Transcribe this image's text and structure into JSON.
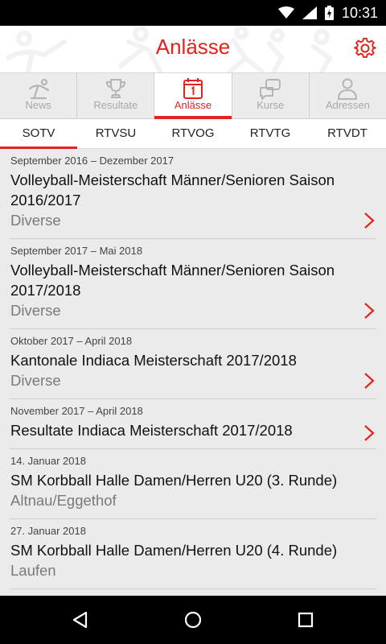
{
  "status": {
    "time": "10:31"
  },
  "header": {
    "title": "Anlässe",
    "settings_icon": "gear-icon",
    "accent_color": "#e4231b"
  },
  "tabs": [
    {
      "label": "News",
      "icon": "gymnast-icon",
      "active": false
    },
    {
      "label": "Resultate",
      "icon": "trophy-icon",
      "active": false
    },
    {
      "label": "Anlässe",
      "icon": "calendar-icon",
      "active": true
    },
    {
      "label": "Kurse",
      "icon": "chat-icon",
      "active": false
    },
    {
      "label": "Adressen",
      "icon": "person-icon",
      "active": false
    }
  ],
  "subtabs": [
    {
      "label": "SOTV",
      "active": true
    },
    {
      "label": "RTVSU",
      "active": false
    },
    {
      "label": "RTVOG",
      "active": false
    },
    {
      "label": "RTVTG",
      "active": false
    },
    {
      "label": "RTVDT",
      "active": false
    }
  ],
  "events": [
    {
      "date": "September 2016 – Dezember 2017",
      "title": "Volleyball-Meisterschaft Männer/Senioren Saison 2016/2017",
      "location": "Diverse",
      "has_chevron": true
    },
    {
      "date": "September 2017 – Mai 2018",
      "title": "Volleyball-Meisterschaft Männer/Senioren Saison 2017/2018",
      "location": "Diverse",
      "has_chevron": true
    },
    {
      "date": "Oktober 2017 – April 2018",
      "title": "Kantonale Indiaca Meisterschaft 2017/2018",
      "location": "Diverse",
      "has_chevron": true
    },
    {
      "date": "November 2017 – April 2018",
      "title": "Resultate Indiaca Meisterschaft 2017/2018",
      "location": "",
      "has_chevron": true
    },
    {
      "date": "14. Januar 2018",
      "title": "SM Korbball Halle Damen/Herren U20 (3. Runde)",
      "location": "Altnau/Eggethof",
      "has_chevron": false
    },
    {
      "date": "27. Januar 2018",
      "title": "SM Korbball Halle Damen/Herren U20 (4. Runde)",
      "location": "Laufen",
      "has_chevron": false
    }
  ]
}
